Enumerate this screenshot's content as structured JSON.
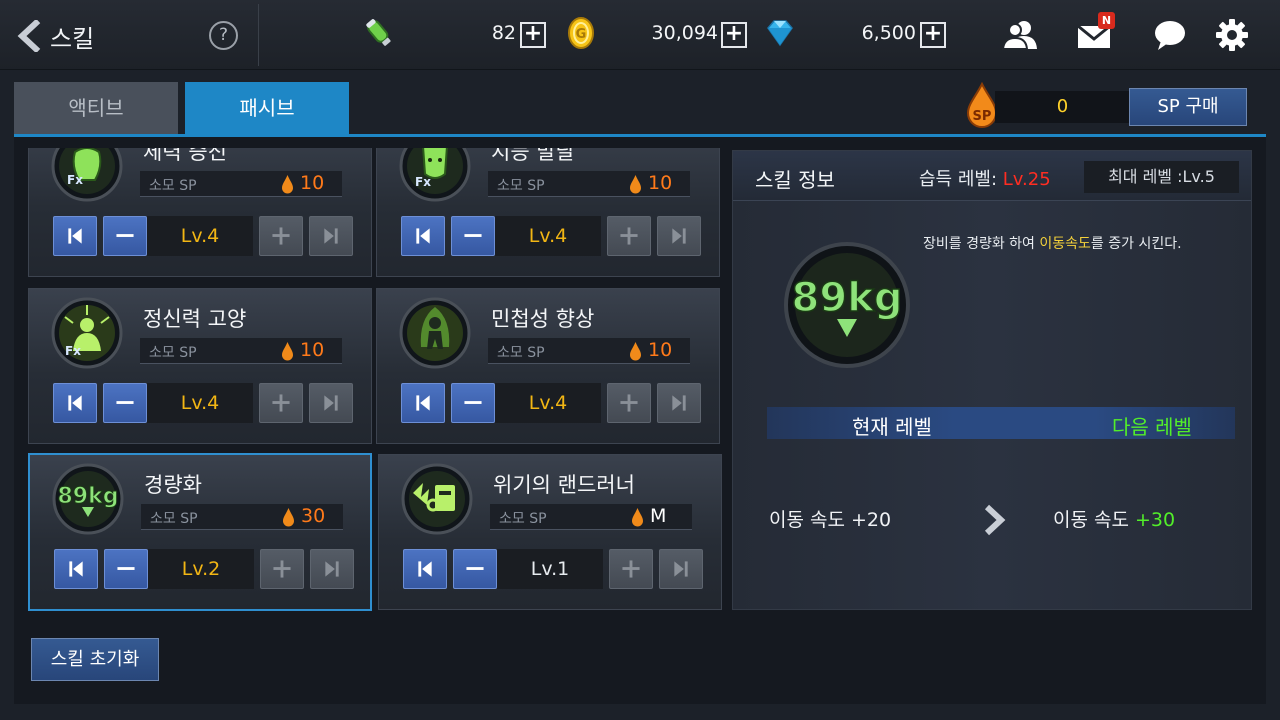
{
  "header": {
    "title": "스킬",
    "help": "?",
    "energy": "82",
    "gold": "30,094",
    "gems": "6,500",
    "mail_badge": "N"
  },
  "tabs": {
    "active": "액티브",
    "passive": "패시브"
  },
  "sp": {
    "icon_text": "SP",
    "value": "0",
    "buy_label": "SP 구매"
  },
  "skills": [
    {
      "name": "체력 증진",
      "sp_label": "소모 SP",
      "cost": "10",
      "level": "Lv.4"
    },
    {
      "name": "지능 발달",
      "sp_label": "소모 SP",
      "cost": "10",
      "level": "Lv.4"
    },
    {
      "name": "정신력 고양",
      "sp_label": "소모 SP",
      "cost": "10",
      "level": "Lv.4"
    },
    {
      "name": "민첩성 향상",
      "sp_label": "소모 SP",
      "cost": "10",
      "level": "Lv.4"
    },
    {
      "name": "경량화",
      "sp_label": "소모 SP",
      "cost": "30",
      "level": "Lv.2"
    },
    {
      "name": "위기의 랜드러너",
      "sp_label": "소모 SP",
      "cost": "M",
      "level": "Lv.1"
    }
  ],
  "info": {
    "title": "스킬 정보",
    "acquire_label": "습득 레벨:",
    "acquire_level": "Lv.25",
    "max_level": "최대 레벨 :Lv.5",
    "desc_pre": "장비를 경량화 하여 ",
    "desc_highlight": "이동속도",
    "desc_post": "를 증가 시킨다.",
    "current_label": "현재 레벨",
    "next_label": "다음 레벨",
    "current_stat": "이동 속도  +20",
    "next_stat_name": "이동 속도  ",
    "next_stat_value": "+30"
  },
  "reset_label": "스킬 초기화",
  "colors": {
    "accent": "#1e87c6",
    "sp_yellow": "#ffd22a",
    "cost_orange": "#ff7a1a",
    "next_green": "#52ee2a",
    "req_red": "#ff2d22"
  }
}
